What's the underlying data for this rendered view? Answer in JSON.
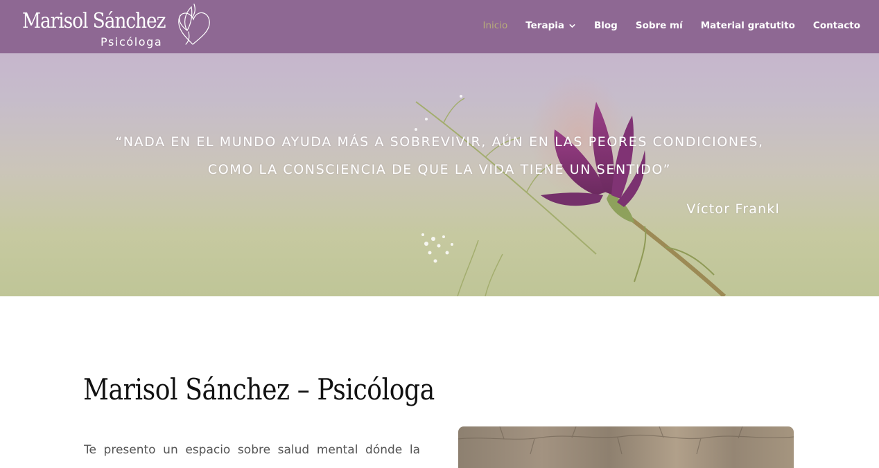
{
  "header": {
    "logo": {
      "name": "Marisol Sánchez",
      "subtitle": "Psicóloga"
    },
    "nav": [
      {
        "label": "Inicio",
        "active": true
      },
      {
        "label": "Terapia",
        "has_dropdown": true
      },
      {
        "label": "Blog"
      },
      {
        "label": "Sobre mí"
      },
      {
        "label": "Material gratutito"
      },
      {
        "label": "Contacto"
      }
    ]
  },
  "hero": {
    "quote_line1": "“Nada en el mundo ayuda más a sobrevivir, aún en las peores condiciones,",
    "quote_line2": "como la consciencia de que la vida tiene un sentido”",
    "author": "Víctor Frankl"
  },
  "content": {
    "title": "Marisol Sánchez – Psicóloga",
    "intro": "Te presento un espacio sobre salud mental dónde la"
  },
  "colors": {
    "header_bg": "#8e6893",
    "nav_active": "#b8ad7a",
    "nav_text": "#ffffff",
    "title_text": "#111111",
    "body_text": "#555555"
  },
  "icons": {
    "dropdown": "chevron-down-icon",
    "logo_mark": "heart-butterfly-icon"
  }
}
